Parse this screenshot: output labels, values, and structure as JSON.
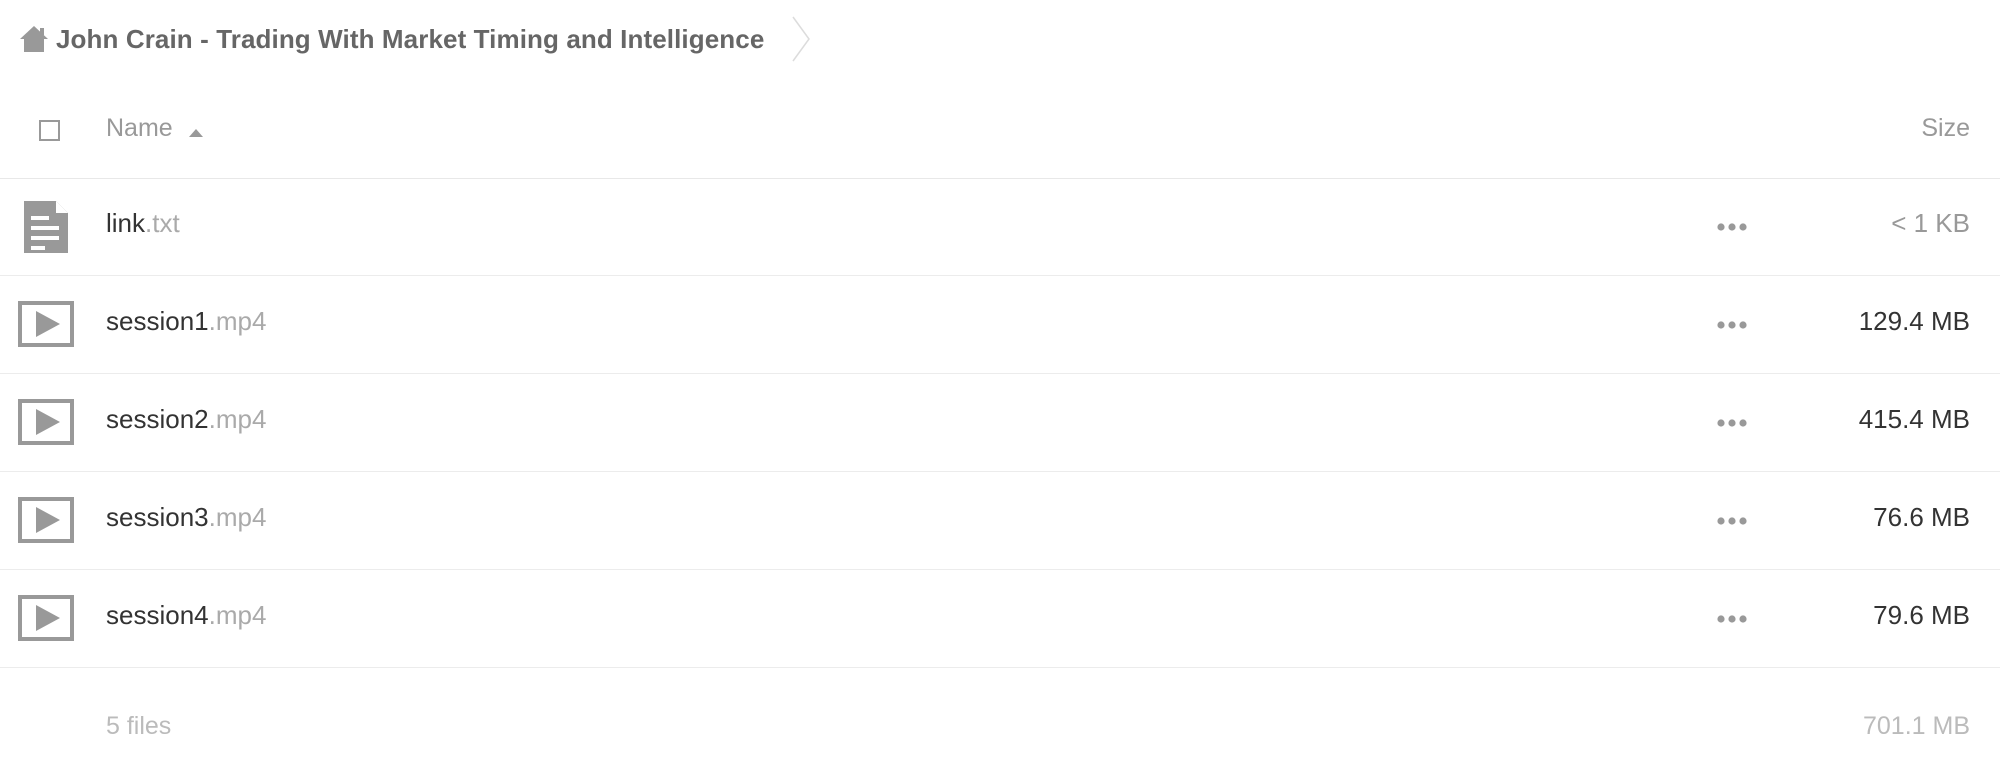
{
  "breadcrumb": {
    "home_icon": "home-icon",
    "folder": "John Crain - Trading With Market Timing and Intelligence",
    "separator_icon": "chevron-right-icon"
  },
  "table": {
    "columns": {
      "name": "Name",
      "size": "Size"
    },
    "sort": {
      "column": "Name",
      "direction": "ascending",
      "icon": "sort-ascending-icon"
    },
    "rows": [
      {
        "base": "link",
        "ext": ".txt",
        "size": "< 1 KB",
        "icon": "text-file-icon",
        "more_icon": "more-options-icon"
      },
      {
        "base": "session1",
        "ext": ".mp4",
        "size": "129.4 MB",
        "icon": "video-file-icon",
        "more_icon": "more-options-icon"
      },
      {
        "base": "session2",
        "ext": ".mp4",
        "size": "415.4 MB",
        "icon": "video-file-icon",
        "more_icon": "more-options-icon"
      },
      {
        "base": "session3",
        "ext": ".mp4",
        "size": "76.6 MB",
        "icon": "video-file-icon",
        "more_icon": "more-options-icon"
      },
      {
        "base": "session4",
        "ext": ".mp4",
        "size": "79.6 MB",
        "icon": "video-file-icon",
        "more_icon": "more-options-icon"
      }
    ]
  },
  "summary": {
    "count": "5 files",
    "total": "701.1 MB"
  },
  "colors": {
    "icon": "#999999",
    "text": "#333333",
    "muted": "#aaaaaa",
    "divider": "#ececec"
  }
}
